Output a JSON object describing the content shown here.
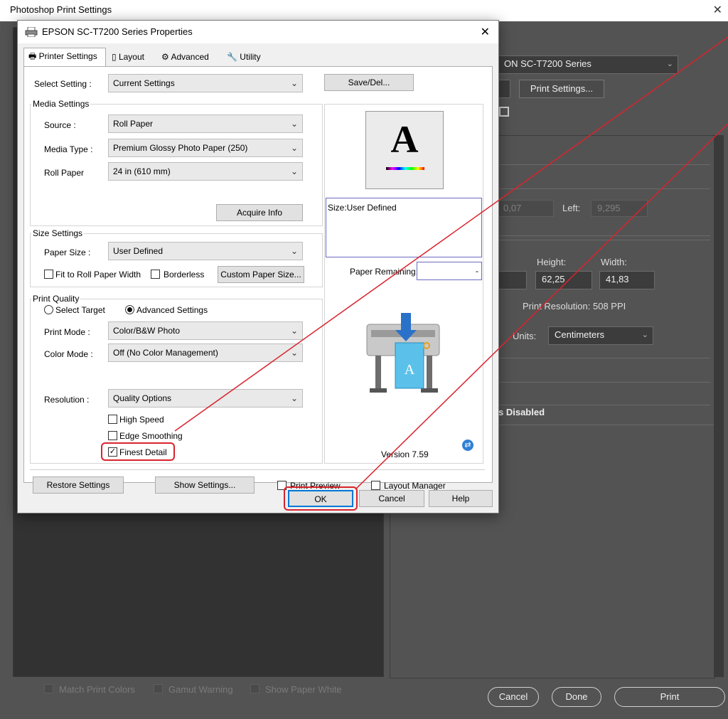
{
  "photoshop": {
    "window_title": "Photoshop Print Settings",
    "printer_value": "EPSON SC-T7200 Series",
    "printer_value_visible": "ON SC-T7200 Series",
    "print_settings_button": "Print Settings...",
    "position": {
      "top_value": "0,07",
      "left_label": "Left:",
      "left_value": "9,295"
    },
    "scaled": {
      "height_label": "Height:",
      "width_label": "Width:",
      "height_value": "62,25",
      "width_value": "41,83",
      "resolution": "Print Resolution: 508 PPI",
      "units_label": "Units:",
      "units_value": "Centimeters"
    },
    "disabled_text": "s Disabled",
    "bottom_checks": [
      "Match Print Colors",
      "Gamut Warning",
      "Show Paper White"
    ],
    "buttons": {
      "cancel": "Cancel",
      "done": "Done",
      "print": "Print"
    }
  },
  "epson": {
    "title": "EPSON SC-T7200 Series Properties",
    "tabs": [
      {
        "label": "Printer Settings",
        "icon": "printer-icon"
      },
      {
        "label": "Layout",
        "icon": "layout-icon"
      },
      {
        "label": "Advanced",
        "icon": "gear-icon"
      },
      {
        "label": "Utility",
        "icon": "wrench-icon"
      }
    ],
    "select_setting": {
      "label": "Select Setting :",
      "value": "Current Settings",
      "save_button": "Save/Del..."
    },
    "media_settings": {
      "title": "Media Settings",
      "source_label": "Source :",
      "source_value": "Roll Paper",
      "media_type_label": "Media Type :",
      "media_type_value": "Premium Glossy Photo Paper (250)",
      "roll_paper_label": "Roll Paper",
      "roll_paper_value": "24 in (610 mm)",
      "acquire_button": "Acquire Info"
    },
    "size_settings": {
      "title": "Size Settings",
      "paper_size_label": "Paper Size :",
      "paper_size_value": "User Defined",
      "fit_roll_label": "Fit to Roll Paper Width",
      "borderless_label": "Borderless",
      "custom_size_button": "Custom Paper Size..."
    },
    "print_quality": {
      "title": "Print Quality",
      "select_target_label": "Select Target",
      "advanced_label": "Advanced Settings",
      "print_mode_label": "Print Mode :",
      "print_mode_value": "Color/B&W Photo",
      "color_mode_label": "Color Mode :",
      "color_mode_value": "Off (No Color Management)",
      "resolution_label": "Resolution :",
      "resolution_value": "Quality Options",
      "high_speed_label": "High Speed",
      "edge_smoothing_label": "Edge Smoothing",
      "finest_detail_label": "Finest Detail"
    },
    "preview": {
      "glyph": "A",
      "size_text": "Size:User Defined",
      "paper_remaining_label": "Paper Remaining:",
      "paper_remaining_value": "-",
      "version": "Version 7.59"
    },
    "bottom": {
      "restore_button": "Restore Settings",
      "show_settings_button": "Show Settings...",
      "print_preview_label": "Print Preview",
      "layout_manager_label": "Layout Manager"
    },
    "buttons": {
      "ok": "OK",
      "cancel": "Cancel",
      "help": "Help"
    },
    "checks": {
      "high_speed": false,
      "edge_smoothing": false,
      "finest_detail": true,
      "fit_roll": false,
      "borderless": false,
      "print_preview": false,
      "layout_manager": false
    },
    "check_glyph": "✓"
  },
  "colors": {
    "annotation_red": "#d9232d",
    "ok_blue": "#0078d7"
  }
}
